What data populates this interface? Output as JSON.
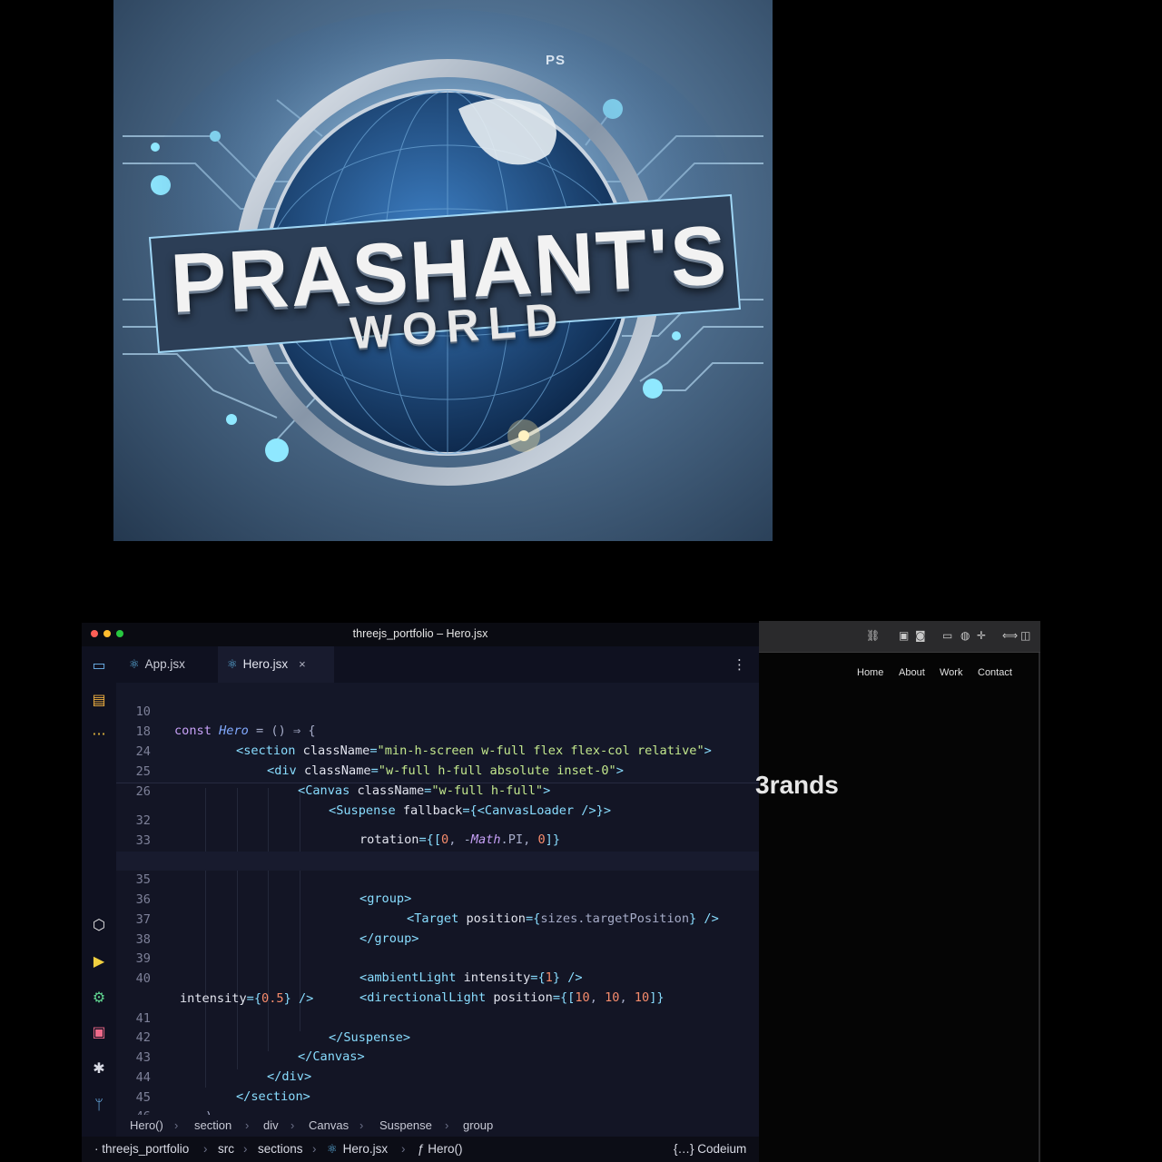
{
  "logo": {
    "title": "PRASHANT'S",
    "subtitle": "WORLD",
    "monogram": "PS"
  },
  "editor": {
    "window_title": "threejs_portfolio – Hero.jsx",
    "tabs": [
      {
        "label": "App.jsx",
        "icon": "react-icon",
        "active": false
      },
      {
        "label": "Hero.jsx",
        "icon": "react-icon",
        "active": true
      }
    ],
    "close_glyph": "×",
    "menu_glyph": "⋮",
    "activity_icons": [
      "project-icon",
      "structure-icon",
      "more-icon",
      "graphql-icon",
      "run-icon",
      "settings-icon",
      "terminal-icon",
      "debug-icon",
      "git-icon"
    ],
    "sticky_lines": [
      {
        "num": "10",
        "code": "const Hero = () ⇒ {"
      },
      {
        "num": "18",
        "code": "<section className=\"min-h-screen w-full flex flex-col relative\">"
      },
      {
        "num": "24",
        "code": "<div className=\"w-full h-full absolute inset-0\">"
      },
      {
        "num": "25",
        "code": "<Canvas className=\"w-full h-full\">"
      },
      {
        "num": "26",
        "code": "<Suspense fallback={<CanvasLoader />}>"
      }
    ],
    "lines": [
      {
        "num": "32",
        "code": "rotation={[0, -Math.PI, 0]}"
      },
      {
        "num": "33",
        "code": "/>"
      },
      {
        "num": "34",
        "code": ""
      },
      {
        "num": "35",
        "code": "<group>"
      },
      {
        "num": "36",
        "code": "<Target position={sizes.targetPosition} />"
      },
      {
        "num": "37",
        "code": "</group>"
      },
      {
        "num": "38",
        "code": ""
      },
      {
        "num": "39",
        "code": "<ambientLight intensity={1} />"
      },
      {
        "num": "40",
        "code": "<directionalLight position={[10, 10, 10]}"
      },
      {
        "num": "",
        "code": "intensity={0.5} />"
      },
      {
        "num": "41",
        "code": "</Suspense>"
      },
      {
        "num": "42",
        "code": "</Canvas>"
      },
      {
        "num": "43",
        "code": "</div>"
      },
      {
        "num": "44",
        "code": "</section>"
      },
      {
        "num": "45",
        "code": ")"
      },
      {
        "num": "46",
        "code": "}"
      }
    ],
    "breadcrumb": [
      "Hero()",
      "section",
      "div",
      "Canvas",
      "Suspense",
      "group"
    ],
    "status_path": [
      "threejs_portfolio",
      "src",
      "sections",
      "Hero.jsx",
      "ƒ Hero()"
    ],
    "status_right": "{…} Codeium"
  },
  "browser": {
    "nav": [
      "Home",
      "About",
      "Work",
      "Contact"
    ],
    "heading_fragment": "3rands"
  },
  "colors": {
    "editor_bg": "#131525",
    "keyword": "#c6a0f6",
    "tag": "#89ddff",
    "string": "#c3e88d",
    "number": "#f78c6c",
    "mac_close": "#ff5f57",
    "mac_min": "#febc2e",
    "mac_max": "#28c840"
  }
}
